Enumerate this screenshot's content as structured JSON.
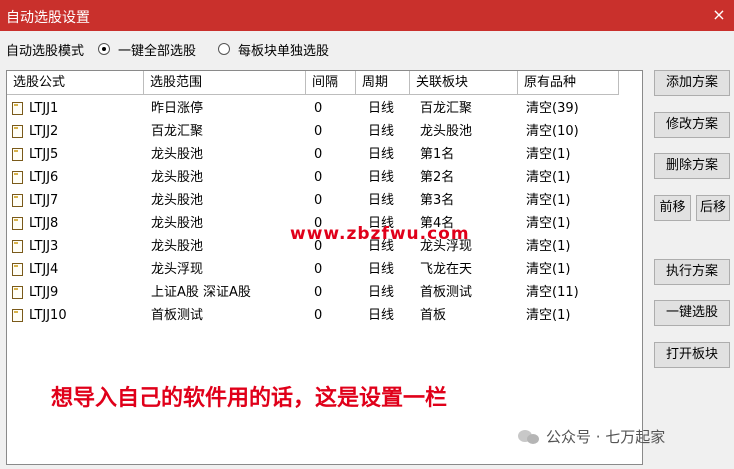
{
  "window": {
    "title": "自动选股设置",
    "close_glyph": "×"
  },
  "mode": {
    "label": "自动选股模式",
    "options": [
      {
        "label": "一键全部选股",
        "selected": true
      },
      {
        "label": "每板块单独选股",
        "selected": false
      }
    ]
  },
  "table": {
    "columns": [
      "选股公式",
      "选股范围",
      "间隔",
      "周期",
      "关联板块",
      "原有品种"
    ],
    "rows": [
      {
        "formula": "LTJJ1",
        "range": "昨日涨停",
        "interval": "0",
        "period": "日线",
        "sector": "百龙汇聚",
        "existing": "清空(39)"
      },
      {
        "formula": "LTJJ2",
        "range": "百龙汇聚",
        "interval": "0",
        "period": "日线",
        "sector": "龙头股池",
        "existing": "清空(10)"
      },
      {
        "formula": "LTJJ5",
        "range": "龙头股池",
        "interval": "0",
        "period": "日线",
        "sector": "第1名",
        "existing": "清空(1)"
      },
      {
        "formula": "LTJJ6",
        "range": "龙头股池",
        "interval": "0",
        "period": "日线",
        "sector": "第2名",
        "existing": "清空(1)"
      },
      {
        "formula": "LTJJ7",
        "range": "龙头股池",
        "interval": "0",
        "period": "日线",
        "sector": "第3名",
        "existing": "清空(1)"
      },
      {
        "formula": "LTJJ8",
        "range": "龙头股池",
        "interval": "0",
        "period": "日线",
        "sector": "第4名",
        "existing": "清空(1)"
      },
      {
        "formula": "LTJJ3",
        "range": "龙头股池",
        "interval": "0",
        "period": "日线",
        "sector": "龙头浮现",
        "existing": "清空(1)"
      },
      {
        "formula": "LTJJ4",
        "range": "龙头浮现",
        "interval": "0",
        "period": "日线",
        "sector": "飞龙在天",
        "existing": "清空(1)"
      },
      {
        "formula": "LTJJ9",
        "range": "上证A股 深证A股",
        "interval": "0",
        "period": "日线",
        "sector": "首板测试",
        "existing": "清空(11)"
      },
      {
        "formula": "LTJJ10",
        "range": "首板测试",
        "interval": "0",
        "period": "日线",
        "sector": "首板",
        "existing": "清空(1)"
      }
    ]
  },
  "buttons": {
    "add": "添加方案",
    "edit": "修改方案",
    "delete": "删除方案",
    "move_up": "前移",
    "move_down": "后移",
    "execute": "执行方案",
    "one_click": "一键选股",
    "open_sector": "打开板块"
  },
  "overlay_caption": "想导入自己的软件用的话，这是设置一栏",
  "site_watermark": "www.zbzfwu.com",
  "wechat_watermark": "公众号 · 七万起家",
  "colors": {
    "titlebar": "#c9302c",
    "caption": "#e0001a"
  }
}
